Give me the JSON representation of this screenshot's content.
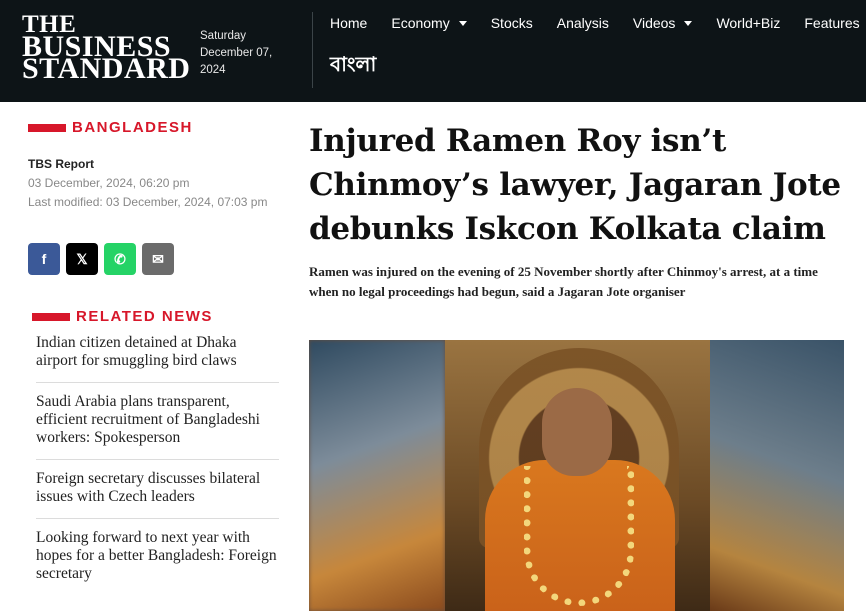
{
  "header": {
    "logo": [
      "THE",
      "BUSINESS",
      "STANDARD"
    ],
    "date_lines": [
      "Saturday",
      "December 07,",
      "2024"
    ],
    "nav": [
      {
        "label": "Home",
        "dropdown": false
      },
      {
        "label": "Economy",
        "dropdown": true
      },
      {
        "label": "Stocks",
        "dropdown": false
      },
      {
        "label": "Analysis",
        "dropdown": false
      },
      {
        "label": "Videos",
        "dropdown": true
      },
      {
        "label": "World+Biz",
        "dropdown": false
      },
      {
        "label": "Features",
        "dropdown": false
      }
    ],
    "bangla_link": "বাংলা"
  },
  "article": {
    "section": "BANGLADESH",
    "author": "TBS Report",
    "published": "03 December, 2024, 06:20 pm",
    "modified": "Last modified: 03 December, 2024, 07:03 pm",
    "headline": "Injured Ramen Roy isn’t Chinmoy’s lawyer, Jagaran Jote debunks Iskcon Kolkata claim",
    "standfirst": "Ramen was injured on the evening of 25 November shortly after Chinmoy's arrest, at a time when no legal proceedings had begun, said a Jagaran Jote organiser"
  },
  "share": {
    "facebook": "f",
    "x": "𝕏",
    "whatsapp": "✆",
    "email": "✉"
  },
  "related": {
    "title": "RELATED NEWS",
    "items": [
      "Indian citizen detained at Dhaka airport for smuggling bird claws",
      "Saudi Arabia plans transparent, efficient recruitment of Bangladeshi workers: Spokesperson",
      "Foreign secretary discusses bilateral issues with Czech leaders",
      "Looking forward to next year with hopes for a better Bangladesh: Foreign secretary"
    ]
  },
  "colors": {
    "header_bg": "#0d1417",
    "accent_red": "#d7172a"
  }
}
